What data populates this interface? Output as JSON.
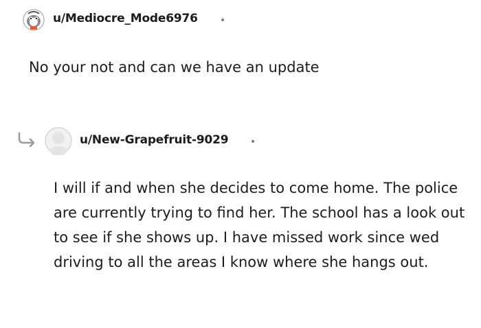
{
  "parent_comment": {
    "username": "u/Mediocre_Mode6976",
    "separator": "•",
    "body": "No your not and can we have an update",
    "avatar_icon": "snoo-avatar-icon"
  },
  "reply_comment": {
    "username": "u/New-Grapefruit-9029",
    "separator": "•",
    "body": "I will if and when she decides to come home. The police are currently trying to find her. The school has a look out to see if she shows up. I have missed work since wed driving to all the areas I know where she hangs out.",
    "avatar_icon": "default-avatar-icon",
    "reply_indicator_icon": "reply-arrow-icon"
  }
}
